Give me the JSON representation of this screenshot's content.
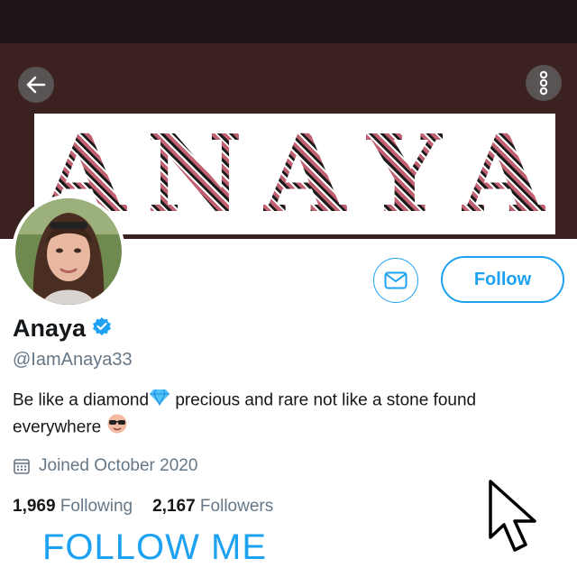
{
  "banner": {
    "text": "ANAYA",
    "letters": [
      "A",
      "N",
      "A",
      "Y",
      "A"
    ]
  },
  "profile": {
    "name": "Anaya",
    "handle": "@IamAnaya33",
    "bio_part1": "Be like a diamond",
    "bio_part2": " precious and rare not like a stone found everywhere ",
    "joined": "Joined October 2020",
    "following_count": "1,969",
    "following_label": "Following",
    "followers_count": "2,167",
    "followers_label": "Followers"
  },
  "actions": {
    "follow_label": "Follow"
  },
  "overlay": {
    "follow_me": "FOLLOW ME"
  },
  "icons": {
    "back": "back-arrow-icon",
    "more": "more-vertical-icon",
    "message": "envelope-icon",
    "verified": "verified-badge-icon",
    "calendar": "calendar-icon",
    "diamond": "diamond-emoji",
    "sunglasses": "sunglasses-emoji",
    "cursor": "mouse-cursor-icon"
  },
  "colors": {
    "accent": "#1da1f2",
    "banner_bg": "#3b2220",
    "topbar": "#1f1416",
    "text": "#14171a",
    "muted": "#657786"
  }
}
